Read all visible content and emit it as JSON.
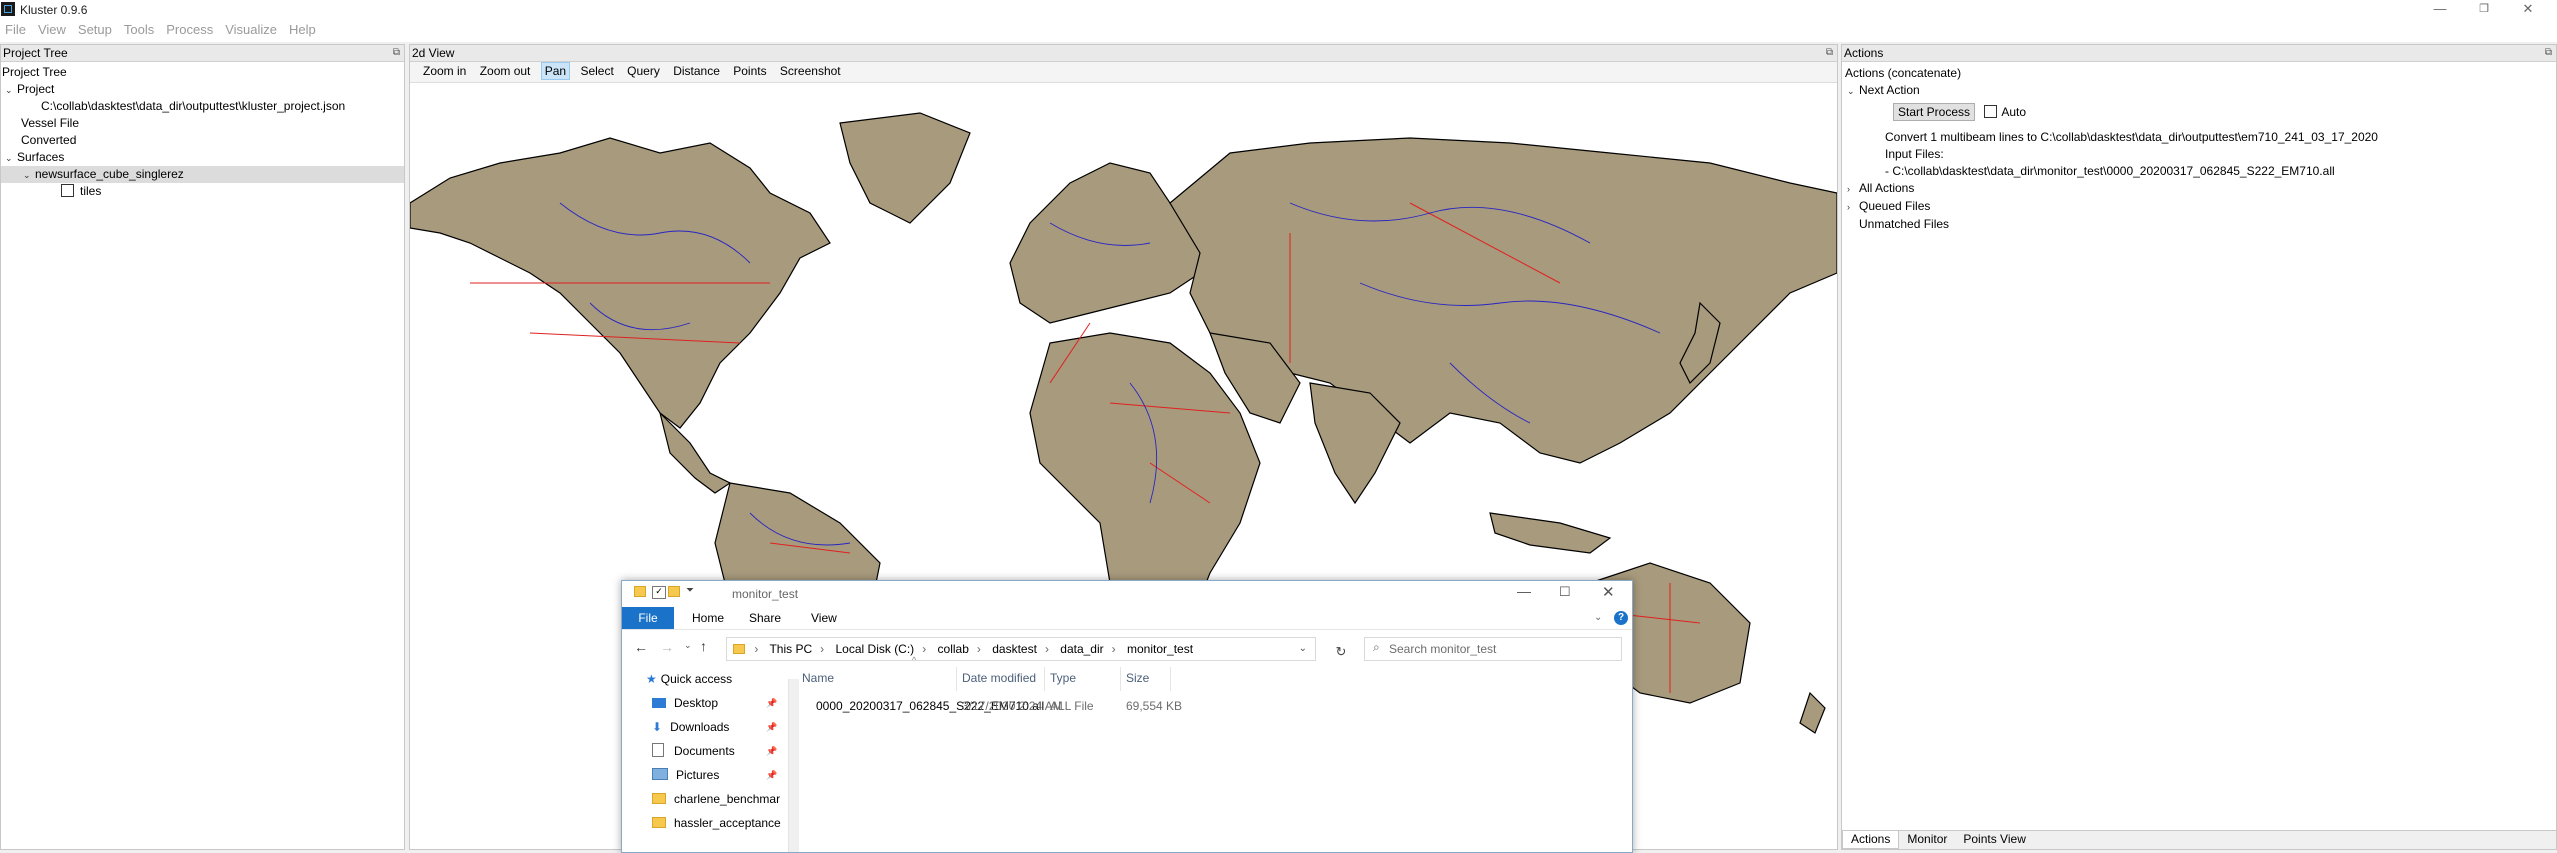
{
  "app": {
    "title": "Kluster 0.9.6",
    "minimize": "—",
    "restore": "❐",
    "close": "✕"
  },
  "menu": [
    "File",
    "View",
    "Setup",
    "Tools",
    "Process",
    "Visualize",
    "Help"
  ],
  "project_tree": {
    "header": "Project Tree",
    "root_label": "Project Tree",
    "project": "Project",
    "project_path": "C:\\collab\\dasktest\\data_dir\\outputtest\\kluster_project.json",
    "vessel_file": "Vessel File",
    "converted": "Converted",
    "surfaces": "Surfaces",
    "surface_name": "newsurface_cube_singlerez",
    "tiles": "tiles"
  },
  "view2d": {
    "header": "2d View",
    "tools": [
      "Zoom in",
      "Zoom out",
      "Pan",
      "Select",
      "Query",
      "Distance",
      "Points",
      "Screenshot"
    ],
    "active_tool": "Pan",
    "colors": {
      "land": "#a89a7c",
      "outline": "#000000",
      "rivers": "#1010d0",
      "borders": "#e02020",
      "water": "#ffffff"
    }
  },
  "actions": {
    "header": "Actions",
    "title": "Actions (concatenate)",
    "next_action": "Next Action",
    "start_process": "Start Process",
    "auto": "Auto",
    "convert_text": "Convert 1 multibeam lines to C:\\collab\\dasktest\\data_dir\\outputtest\\em710_241_03_17_2020",
    "input_files_label": "Input Files:",
    "input_file": "- C:\\collab\\dasktest\\data_dir\\monitor_test\\0000_20200317_062845_S222_EM710.all",
    "all_actions": "All Actions",
    "queued_files": "Queued Files",
    "unmatched_files": "Unmatched Files",
    "tabs": [
      "Actions",
      "Monitor",
      "Points View"
    ]
  },
  "explorer": {
    "title": "monitor_test",
    "ribbon": [
      "File",
      "Home",
      "Share",
      "View"
    ],
    "path": [
      "This PC",
      "Local Disk (C:)",
      "collab",
      "dasktest",
      "data_dir",
      "monitor_test"
    ],
    "search_placeholder": "Search monitor_test",
    "nav": [
      "Quick access",
      "Desktop",
      "Downloads",
      "Documents",
      "Pictures",
      "charlene_benchmar",
      "hassler_acceptance"
    ],
    "columns": [
      "Name",
      "Date modified",
      "Type",
      "Size"
    ],
    "files": [
      {
        "name": "0000_20200317_062845_S222_EM710.all",
        "date": "3/17/2020 2:24 AM",
        "type": "ALL File",
        "size": "69,554 KB"
      }
    ],
    "accent": "#1a73c8"
  }
}
